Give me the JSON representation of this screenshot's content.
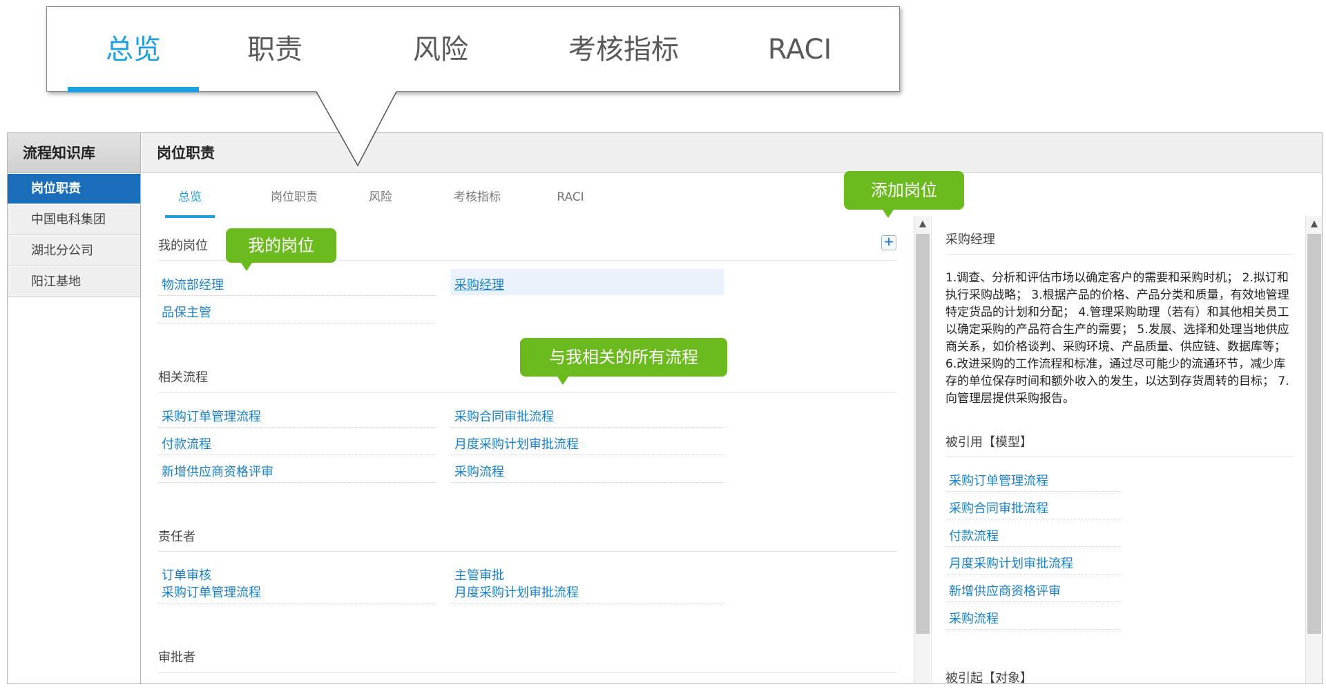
{
  "callout": {
    "tabs": [
      {
        "label": "总览",
        "active": true
      },
      {
        "label": "职责",
        "active": false
      },
      {
        "label": "风险",
        "active": false
      },
      {
        "label": "考核指标",
        "active": false
      },
      {
        "label": "RACI",
        "active": false
      }
    ]
  },
  "sidebar": {
    "title": "流程知识库",
    "items": [
      {
        "label": "岗位职责",
        "active": true
      },
      {
        "label": "中国电科集团",
        "active": false
      },
      {
        "label": "湖北分公司",
        "active": false
      },
      {
        "label": "阳江基地",
        "active": false
      }
    ]
  },
  "header": {
    "title": "岗位职责"
  },
  "tabs": [
    {
      "label": "总览",
      "active": true
    },
    {
      "label": "岗位职责",
      "active": false
    },
    {
      "label": "风险",
      "active": false
    },
    {
      "label": "考核指标",
      "active": false
    },
    {
      "label": "RACI",
      "active": false
    }
  ],
  "my_positions": {
    "title": "我的岗位",
    "items": [
      "物流部经理",
      "采购经理",
      "品保主管"
    ]
  },
  "related_processes": {
    "title": "相关流程",
    "items": [
      "采购订单管理流程",
      "采购合同审批流程",
      "付款流程",
      "月度采购计划审批流程",
      "新增供应商资格评审",
      "采购流程"
    ]
  },
  "responsible": {
    "title": "责任者",
    "items": [
      {
        "task": "订单审核",
        "process": "采购订单管理流程"
      },
      {
        "task": "主管审批",
        "process": "月度采购计划审批流程"
      }
    ]
  },
  "approver": {
    "title": "审批者"
  },
  "detail": {
    "title": "采购经理",
    "description": "1.调查、分析和评估市场以确定客户的需要和采购时机； 2.拟订和执行采购战略； 3.根据产品的价格、产品分类和质量，有效地管理特定货品的计划和分配； 4.管理采购助理（若有）和其他相关员工以确定采购的产品符合生产的需要； 5.发展、选择和处理当地供应商关系，如价格谈判、采购环境、产品质量、供应链、数据库等； 6.改进采购的工作流程和标准，通过尽可能少的流通环节，减少库存的单位保存时间和额外收入的发生，以达到存货周转的目标； 7.向管理层提供采购报告。",
    "cited_model_title": "被引用【模型】",
    "cited_model_items": [
      "采购订单管理流程",
      "采购合同审批流程",
      "付款流程",
      "月度采购计划审批流程",
      "新增供应商资格评审",
      "采购流程"
    ],
    "cited_object_title": "被引起【对象】"
  },
  "tooltips": {
    "my_positions": "我的岗位",
    "related_processes": "与我相关的所有流程",
    "add_position": "添加岗位"
  },
  "colors": {
    "accent": "#1e9fe0",
    "link": "#1a7fc4",
    "sidebar_active": "#1a6db8",
    "tooltip": "#6bbb1e"
  },
  "icons": {
    "add": "plus-icon",
    "scroll_up": "chevron-up-icon"
  }
}
